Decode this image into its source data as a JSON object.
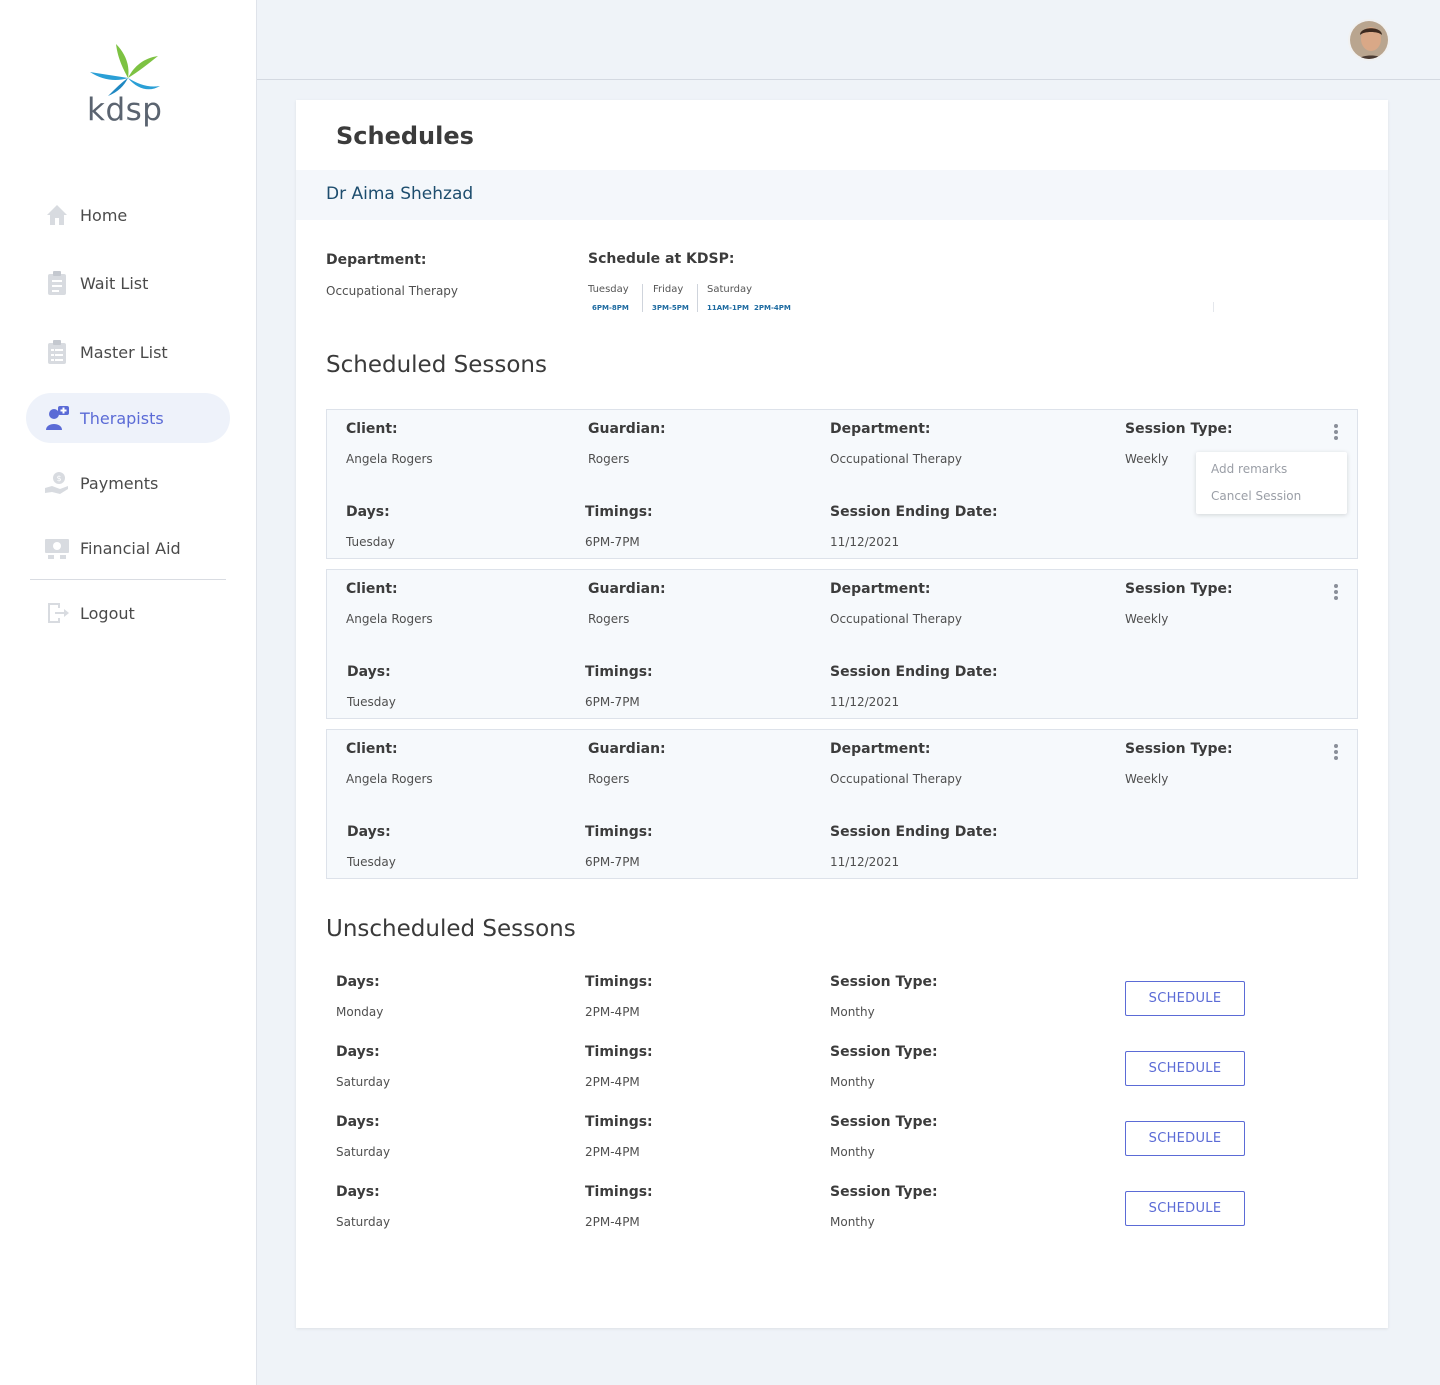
{
  "brand": {
    "name": "kdsp"
  },
  "sidebar": {
    "items": [
      {
        "label": "Home",
        "icon": "home-icon"
      },
      {
        "label": "Wait List",
        "icon": "clipboard-icon"
      },
      {
        "label": "Master List",
        "icon": "checklist-icon"
      },
      {
        "label": "Therapists",
        "icon": "therapist-icon",
        "active": true
      },
      {
        "label": "Payments",
        "icon": "payment-hand-icon"
      },
      {
        "label": "Financial Aid",
        "icon": "financial-aid-icon"
      },
      {
        "label": "Logout",
        "icon": "logout-icon"
      }
    ]
  },
  "colors": {
    "accent": "#5b6bd6",
    "doctor": "#1d4d6e",
    "logo_green": "#7dc242",
    "logo_blue": "#2a9fd6"
  },
  "page": {
    "title": "Schedules",
    "doctor_name": "Dr Aima Shehzad",
    "department_label": "Department:",
    "department_value": "Occupational Therapy",
    "schedule_label": "Schedule at KDSP:",
    "schedule": [
      {
        "day": "Tuesday",
        "times": [
          "6PM-8PM"
        ]
      },
      {
        "day": "Friday",
        "times": [
          "3PM-5PM"
        ]
      },
      {
        "day": "Saturday",
        "times": [
          "11AM-1PM",
          "2PM-4PM"
        ]
      }
    ]
  },
  "scheduled": {
    "title": "Scheduled Sessons",
    "labels": {
      "client": "Client:",
      "guardian": "Guardian:",
      "department": "Department:",
      "session_type": "Session Type:",
      "days": "Days:",
      "timings": "Timings:",
      "ending": "Session Ending Date:"
    },
    "rows": [
      {
        "client": "Angela Rogers",
        "guardian": "Rogers",
        "department": "Occupational Therapy",
        "session_type": "Weekly",
        "days": "Tuesday",
        "timings": "6PM-7PM",
        "ending": "11/12/2021"
      },
      {
        "client": "Angela Rogers",
        "guardian": "Rogers",
        "department": "Occupational Therapy",
        "session_type": "Weekly",
        "days": "Tuesday",
        "timings": "6PM-7PM",
        "ending": "11/12/2021"
      },
      {
        "client": "Angela Rogers",
        "guardian": "Rogers",
        "department": "Occupational Therapy",
        "session_type": "Weekly",
        "days": "Tuesday",
        "timings": "6PM-7PM",
        "ending": "11/12/2021"
      }
    ],
    "menu": {
      "add_remarks": "Add remarks",
      "cancel_session": "Cancel Session"
    }
  },
  "unscheduled": {
    "title": "Unscheduled Sessons",
    "labels": {
      "days": "Days:",
      "timings": "Timings:",
      "session_type": "Session Type:"
    },
    "button_label": "SCHEDULE",
    "rows": [
      {
        "days": "Monday",
        "timings": "2PM-4PM",
        "session_type": "Monthy"
      },
      {
        "days": "Saturday",
        "timings": "2PM-4PM",
        "session_type": "Monthy"
      },
      {
        "days": "Saturday",
        "timings": "2PM-4PM",
        "session_type": "Monthy"
      },
      {
        "days": "Saturday",
        "timings": "2PM-4PM",
        "session_type": "Monthy"
      }
    ]
  }
}
